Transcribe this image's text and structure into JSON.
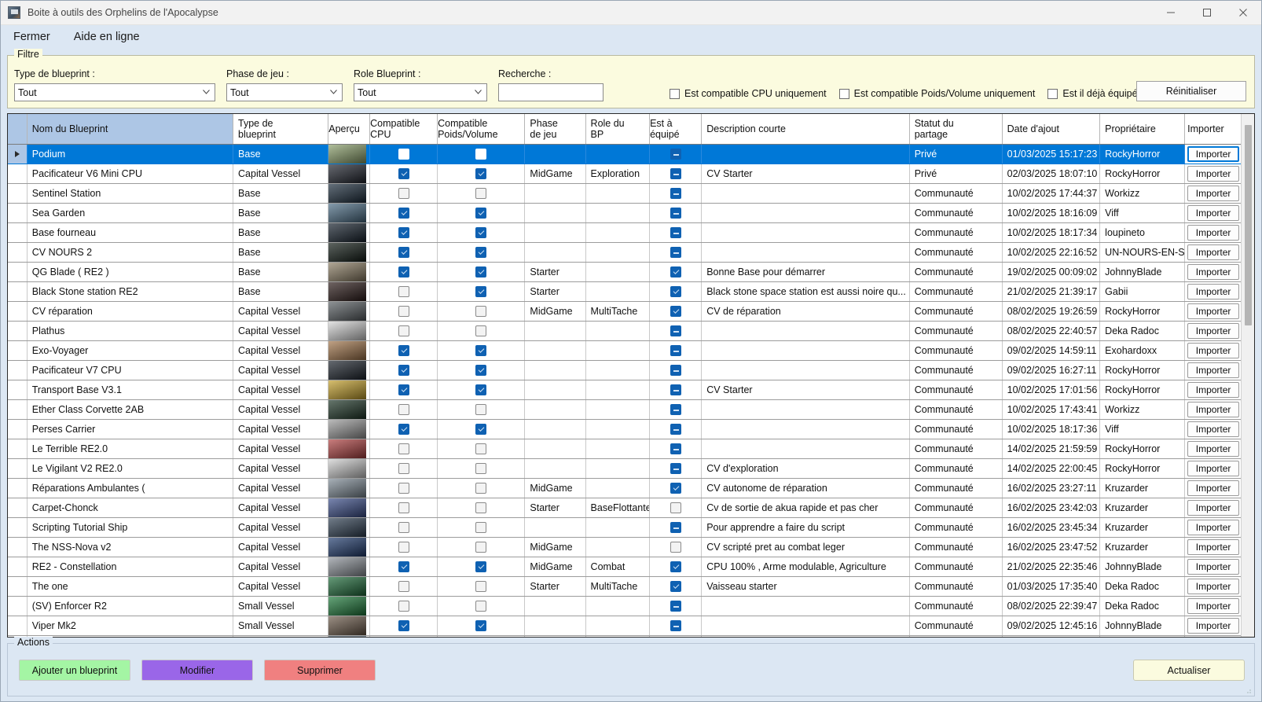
{
  "window": {
    "title": "Boite à outils des Orphelins de l'Apocalypse",
    "minimize_label": "—",
    "maximize_label": "□",
    "close_label": "✕"
  },
  "menu": {
    "items": [
      {
        "label": "Fermer"
      },
      {
        "label": "Aide en ligne"
      }
    ]
  },
  "filter": {
    "legend": "Filtre",
    "type_label": "Type de blueprint :",
    "type_value": "Tout",
    "phase_label": "Phase de jeu :",
    "phase_value": "Tout",
    "role_label": "Role Blueprint :",
    "role_value": "Tout",
    "search_label": "Recherche :",
    "search_value": "",
    "search_placeholder": "",
    "check_cpu": "Est compatible CPU uniquement",
    "check_pv": "Est compatible Poids/Volume uniquement",
    "check_eq": "Est il déjà équipé ?",
    "reset_label": "Réinitialiser"
  },
  "grid": {
    "columns": [
      {
        "key": "sel",
        "label": ""
      },
      {
        "key": "name",
        "label": "Nom du Blueprint"
      },
      {
        "key": "type",
        "label": "Type de\nblueprint"
      },
      {
        "key": "prev",
        "label": "Aperçu"
      },
      {
        "key": "cpu",
        "label": "Compatible\nCPU"
      },
      {
        "key": "pv",
        "label": "Compatible\nPoids/Volume"
      },
      {
        "key": "phase",
        "label": "Phase\nde jeu"
      },
      {
        "key": "role",
        "label": "Role du\nBP"
      },
      {
        "key": "eq",
        "label": "Est à\néquipé"
      },
      {
        "key": "desc",
        "label": "Description courte"
      },
      {
        "key": "stat",
        "label": "Statut du\npartage"
      },
      {
        "key": "date",
        "label": "Date d'ajout"
      },
      {
        "key": "owner",
        "label": "Propriétaire"
      },
      {
        "key": "import",
        "label": "Importer"
      }
    ],
    "import_label": "Importer",
    "rows": [
      {
        "selected": true,
        "name": "Podium",
        "type": "Base",
        "thumb": "#8ba06b",
        "cpu": "unchecked",
        "pv": "unchecked",
        "phase": "",
        "role": "",
        "eq": "indeterminate",
        "desc": "",
        "stat": "Privé",
        "date": "01/03/2025 15:17:23",
        "owner": "RockyHorror"
      },
      {
        "selected": false,
        "name": "Pacificateur V6 Mini CPU",
        "type": "Capital Vessel",
        "thumb": "#20242e",
        "cpu": "checked",
        "pv": "checked",
        "phase": "MidGame",
        "role": "Exploration",
        "eq": "indeterminate",
        "desc": "CV Starter",
        "stat": "Privé",
        "date": "02/03/2025 18:07:10",
        "owner": "RockyHorror"
      },
      {
        "selected": false,
        "name": "Sentinel Station",
        "type": "Base",
        "thumb": "#1b2c3c",
        "cpu": "unchecked",
        "pv": "unchecked",
        "phase": "",
        "role": "",
        "eq": "indeterminate",
        "desc": "",
        "stat": "Communauté",
        "date": "10/02/2025 17:44:37",
        "owner": "Workizz"
      },
      {
        "selected": false,
        "name": "Sea Garden",
        "type": "Base",
        "thumb": "#4b6d86",
        "cpu": "checked",
        "pv": "checked",
        "phase": "",
        "role": "",
        "eq": "indeterminate",
        "desc": "",
        "stat": "Communauté",
        "date": "10/02/2025 18:16:09",
        "owner": "Viff"
      },
      {
        "selected": false,
        "name": "Base fourneau",
        "type": "Base",
        "thumb": "#15202c",
        "cpu": "checked",
        "pv": "checked",
        "phase": "",
        "role": "",
        "eq": "indeterminate",
        "desc": "",
        "stat": "Communauté",
        "date": "10/02/2025 18:17:34",
        "owner": "loupineto"
      },
      {
        "selected": false,
        "name": "CV NOURS 2",
        "type": "Base",
        "thumb": "#101a14",
        "cpu": "checked",
        "pv": "checked",
        "phase": "",
        "role": "",
        "eq": "indeterminate",
        "desc": "",
        "stat": "Communauté",
        "date": "10/02/2025 22:16:52",
        "owner": "UN-NOURS-EN-SLIP"
      },
      {
        "selected": false,
        "name": "QG Blade ( RE2 )",
        "type": "Base",
        "thumb": "#8b7d63",
        "cpu": "checked",
        "pv": "checked",
        "phase": "Starter",
        "role": "",
        "eq": "checked",
        "desc": "Bonne Base pour démarrer",
        "stat": "Communauté",
        "date": "19/02/2025 00:09:02",
        "owner": "JohnnyBlade"
      },
      {
        "selected": false,
        "name": "Black Stone station RE2",
        "type": "Base",
        "thumb": "#2b1a18",
        "cpu": "unchecked",
        "pv": "checked",
        "phase": "Starter",
        "role": "",
        "eq": "checked",
        "desc": "Black stone space station est aussi noire qu...",
        "stat": "Communauté",
        "date": "21/02/2025 21:39:17",
        "owner": "Gabii"
      },
      {
        "selected": false,
        "name": "CV réparation",
        "type": "Capital Vessel",
        "thumb": "#585e62",
        "cpu": "unchecked",
        "pv": "unchecked",
        "phase": "MidGame",
        "role": "MultiTache",
        "eq": "checked",
        "desc": "CV de réparation",
        "stat": "Communauté",
        "date": "08/02/2025 19:26:59",
        "owner": "RockyHorror"
      },
      {
        "selected": false,
        "name": "Plathus",
        "type": "Capital Vessel",
        "thumb": "#d6d6d6",
        "cpu": "unchecked",
        "pv": "unchecked",
        "phase": "",
        "role": "",
        "eq": "indeterminate",
        "desc": "",
        "stat": "Communauté",
        "date": "08/02/2025 22:40:57",
        "owner": "Deka Radoc"
      },
      {
        "selected": false,
        "name": "Exo-Voyager",
        "type": "Capital Vessel",
        "thumb": "#a2754a",
        "cpu": "checked",
        "pv": "checked",
        "phase": "",
        "role": "",
        "eq": "indeterminate",
        "desc": "",
        "stat": "Communauté",
        "date": "09/02/2025 14:59:11",
        "owner": "Exohardoxx"
      },
      {
        "selected": false,
        "name": "Pacificateur V7 CPU",
        "type": "Capital Vessel",
        "thumb": "#1b222b",
        "cpu": "checked",
        "pv": "checked",
        "phase": "",
        "role": "",
        "eq": "indeterminate",
        "desc": "",
        "stat": "Communauté",
        "date": "09/02/2025 16:27:11",
        "owner": "RockyHorror"
      },
      {
        "selected": false,
        "name": "Transport Base V3.1",
        "type": "Capital Vessel",
        "thumb": "#c4a02a",
        "cpu": "checked",
        "pv": "checked",
        "phase": "",
        "role": "",
        "eq": "indeterminate",
        "desc": "CV Starter",
        "stat": "Communauté",
        "date": "10/02/2025 17:01:56",
        "owner": "RockyHorror"
      },
      {
        "selected": false,
        "name": "Ether Class Corvette 2AB",
        "type": "Capital Vessel",
        "thumb": "#1d3526",
        "cpu": "unchecked",
        "pv": "unchecked",
        "phase": "",
        "role": "",
        "eq": "indeterminate",
        "desc": "",
        "stat": "Communauté",
        "date": "10/02/2025 17:43:41",
        "owner": "Workizz"
      },
      {
        "selected": false,
        "name": "Perses Carrier",
        "type": "Capital Vessel",
        "thumb": "#9a9a9a",
        "cpu": "checked",
        "pv": "checked",
        "phase": "",
        "role": "",
        "eq": "indeterminate",
        "desc": "",
        "stat": "Communauté",
        "date": "10/02/2025 18:17:36",
        "owner": "Viff"
      },
      {
        "selected": false,
        "name": "Le Terrible RE2.0",
        "type": "Capital Vessel",
        "thumb": "#b04040",
        "cpu": "unchecked",
        "pv": "unchecked",
        "phase": "",
        "role": "",
        "eq": "indeterminate",
        "desc": "",
        "stat": "Communauté",
        "date": "14/02/2025 21:59:59",
        "owner": "RockyHorror"
      },
      {
        "selected": false,
        "name": "Le Vigilant V2 RE2.0",
        "type": "Capital Vessel",
        "thumb": "#cfcfcf",
        "cpu": "unchecked",
        "pv": "unchecked",
        "phase": "",
        "role": "",
        "eq": "indeterminate",
        "desc": "CV d'exploration",
        "stat": "Communauté",
        "date": "14/02/2025 22:00:45",
        "owner": "RockyHorror"
      },
      {
        "selected": false,
        "name": "Réparations Ambulantes (",
        "type": "Capital Vessel",
        "thumb": "#7e8b96",
        "cpu": "unchecked",
        "pv": "unchecked",
        "phase": "MidGame",
        "role": "",
        "eq": "checked",
        "desc": "CV autonome de réparation",
        "stat": "Communauté",
        "date": "16/02/2025 23:27:11",
        "owner": "Kruzarder"
      },
      {
        "selected": false,
        "name": "Carpet-Chonck",
        "type": "Capital Vessel",
        "thumb": "#3a4d8a",
        "cpu": "unchecked",
        "pv": "unchecked",
        "phase": "Starter",
        "role": "BaseFlottante",
        "eq": "unchecked",
        "desc": "Cv de sortie de akua rapide et pas cher",
        "stat": "Communauté",
        "date": "16/02/2025 23:42:03",
        "owner": "Kruzarder"
      },
      {
        "selected": false,
        "name": "Scripting Tutorial Ship",
        "type": "Capital Vessel",
        "thumb": "#2e3f52",
        "cpu": "unchecked",
        "pv": "unchecked",
        "phase": "",
        "role": "",
        "eq": "indeterminate",
        "desc": "Pour apprendre a faire du script",
        "stat": "Communauté",
        "date": "16/02/2025 23:45:34",
        "owner": "Kruzarder"
      },
      {
        "selected": false,
        "name": "The NSS-Nova v2",
        "type": "Capital Vessel",
        "thumb": "#1f3b6e",
        "cpu": "unchecked",
        "pv": "unchecked",
        "phase": "MidGame",
        "role": "",
        "eq": "unchecked",
        "desc": "CV scripté pret au combat leger",
        "stat": "Communauté",
        "date": "16/02/2025 23:47:52",
        "owner": "Kruzarder"
      },
      {
        "selected": false,
        "name": "RE2 - Constellation",
        "type": "Capital Vessel",
        "thumb": "#8d939a",
        "cpu": "checked",
        "pv": "checked",
        "phase": "MidGame",
        "role": "Combat",
        "eq": "checked",
        "desc": "CPU 100% , Arme modulable, Agriculture",
        "stat": "Communauté",
        "date": "21/02/2025 22:35:46",
        "owner": "JohnnyBlade"
      },
      {
        "selected": false,
        "name": "The one",
        "type": "Capital Vessel",
        "thumb": "#1d6b39",
        "cpu": "unchecked",
        "pv": "unchecked",
        "phase": "Starter",
        "role": "MultiTache",
        "eq": "checked",
        "desc": "Vaisseau starter",
        "stat": "Communauté",
        "date": "01/03/2025 17:35:40",
        "owner": "Deka Radoc"
      },
      {
        "selected": false,
        "name": "(SV) Enforcer R2",
        "type": "Small Vessel",
        "thumb": "#1d7a3a",
        "cpu": "unchecked",
        "pv": "unchecked",
        "phase": "",
        "role": "",
        "eq": "indeterminate",
        "desc": "",
        "stat": "Communauté",
        "date": "08/02/2025 22:39:47",
        "owner": "Deka Radoc"
      },
      {
        "selected": false,
        "name": "Viper Mk2",
        "type": "Small Vessel",
        "thumb": "#6c5a4a",
        "cpu": "checked",
        "pv": "checked",
        "phase": "",
        "role": "",
        "eq": "indeterminate",
        "desc": "",
        "stat": "Communauté",
        "date": "09/02/2025 12:45:16",
        "owner": "JohnnyBlade"
      }
    ]
  },
  "actions": {
    "legend": "Actions",
    "add_label": "Ajouter un blueprint",
    "edit_label": "Modifier",
    "delete_label": "Supprimer",
    "refresh_label": "Actualiser"
  }
}
